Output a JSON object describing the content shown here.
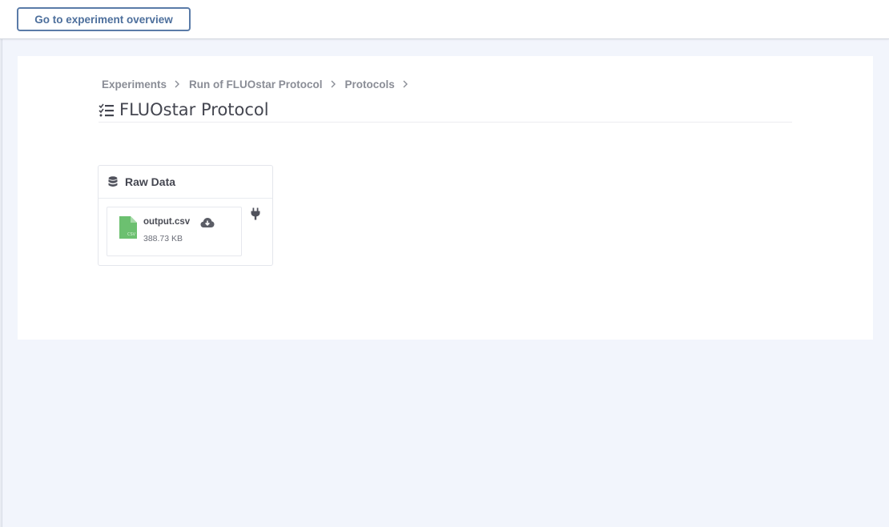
{
  "header": {
    "overview_button_label": "Go to experiment overview"
  },
  "breadcrumb": {
    "items": [
      "Experiments",
      "Run of FLUOstar Protocol",
      "Protocols"
    ]
  },
  "page": {
    "title": "FLUOstar Protocol",
    "title_icon": "list-check-icon"
  },
  "raw_data_card": {
    "title": "Raw Data",
    "icon": "database-icon",
    "file": {
      "name": "output.csv",
      "size": "388.73 KB",
      "type_label": "CSV",
      "icon": "csv-file-icon",
      "icon_color": "#6cc070",
      "action_icon": "cloud-download-icon"
    },
    "side_action_icon": "plug-icon"
  }
}
